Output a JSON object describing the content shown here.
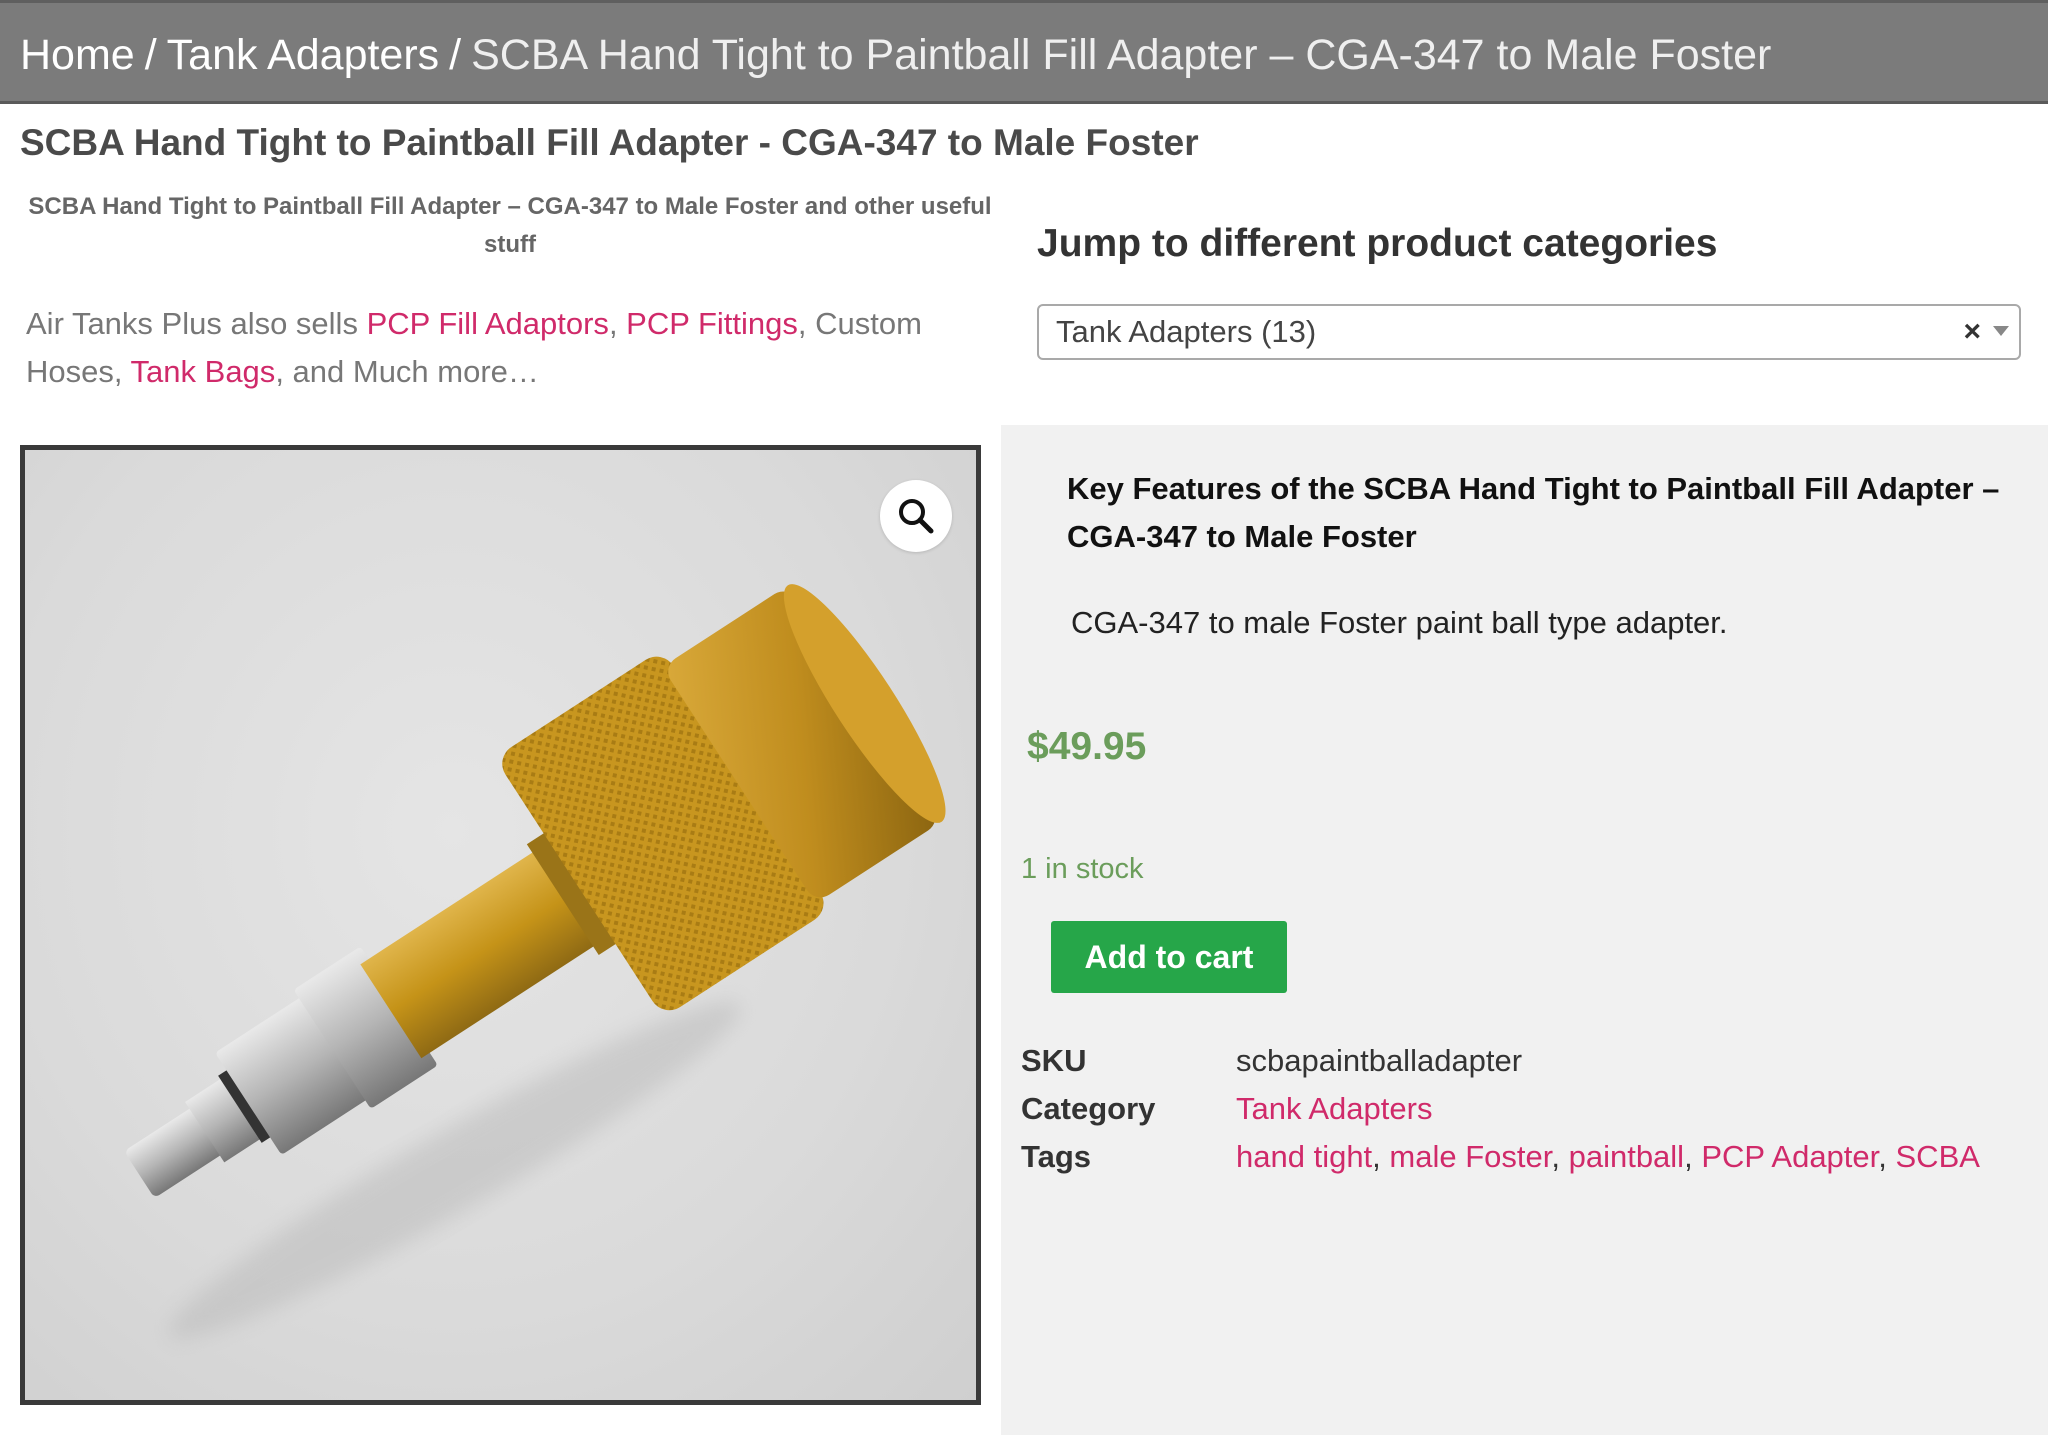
{
  "breadcrumb": {
    "home": "Home",
    "category": "Tank Adapters",
    "current": "SCBA Hand Tight to Paintball Fill Adapter – CGA-347 to Male Foster",
    "separator": "/"
  },
  "page_title": "SCBA Hand Tight to Paintball Fill Adapter - CGA-347 to Male Foster",
  "subtitle": "SCBA Hand Tight to Paintball Fill Adapter – CGA-347 to Male Foster and other useful stuff",
  "intro": {
    "prefix": "Air Tanks Plus also sells ",
    "link1": "PCP Fill Adaptors",
    "comma1": ", ",
    "link2": "PCP Fittings",
    "middle": ", Custom Hoses, ",
    "link3": "Tank Bags",
    "suffix": ", and Much more…"
  },
  "category_jump": {
    "heading": "Jump to different product categories",
    "selected": "Tank Adapters  (13)",
    "clear_symbol": "×"
  },
  "gallery": {
    "zoom_icon": "magnifier-icon"
  },
  "summary": {
    "features_heading": "Key Features of the SCBA Hand Tight to Paintball Fill Adapter – CGA-347 to Male Foster",
    "features_text": "CGA-347 to male Foster paint ball type adapter.",
    "price": "$49.95",
    "stock": "1 in stock",
    "add_to_cart": "Add to cart"
  },
  "meta": {
    "sku_label": "SKU",
    "sku_value": "scbapaintballadapter",
    "category_label": "Category",
    "category_value": "Tank Adapters",
    "tags_label": "Tags",
    "tags": [
      "hand tight",
      "male Foster",
      "paintball",
      "PCP Adapter",
      "SCBA"
    ],
    "tag_separator": ", "
  },
  "colors": {
    "link_pink": "#d02a6a",
    "price_green": "#6b9d5b",
    "button_green": "#26a649",
    "breadcrumb_bg": "#7b7b7b"
  }
}
